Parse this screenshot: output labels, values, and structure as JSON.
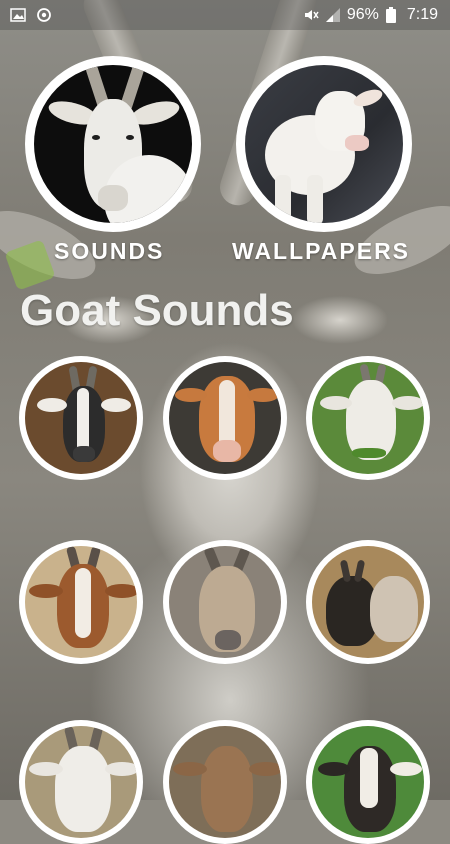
{
  "status_bar": {
    "battery_percent": "96%",
    "time": "7:19"
  },
  "features": [
    {
      "label": "SOUNDS"
    },
    {
      "label": "WALLPAPERS"
    }
  ],
  "section_title": "Goat Sounds",
  "sound_items": [
    {
      "icon": "goat-photo"
    },
    {
      "icon": "goat-photo"
    },
    {
      "icon": "goat-photo"
    },
    {
      "icon": "goat-photo"
    },
    {
      "icon": "goat-photo"
    },
    {
      "icon": "goat-photo"
    },
    {
      "icon": "goat-photo"
    },
    {
      "icon": "goat-photo"
    },
    {
      "icon": "goat-photo"
    }
  ],
  "colors": {
    "overlay": "#8d8a82",
    "text": "#ffffff",
    "circle_border": "#ffffff"
  }
}
